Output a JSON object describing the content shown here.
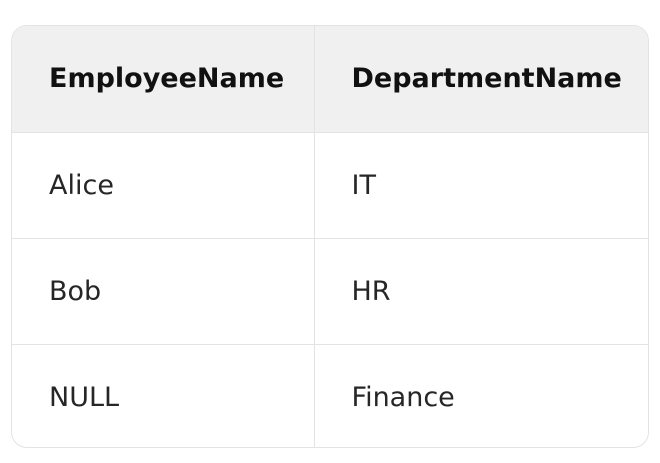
{
  "table": {
    "headers": [
      "EmployeeName",
      "DepartmentName"
    ],
    "rows": [
      [
        "Alice",
        "IT"
      ],
      [
        "Bob",
        "HR"
      ],
      [
        "NULL",
        "Finance"
      ]
    ]
  },
  "colors": {
    "header_background": "#f0f0f0",
    "border": "#e3e3e3",
    "text": "#262626"
  }
}
